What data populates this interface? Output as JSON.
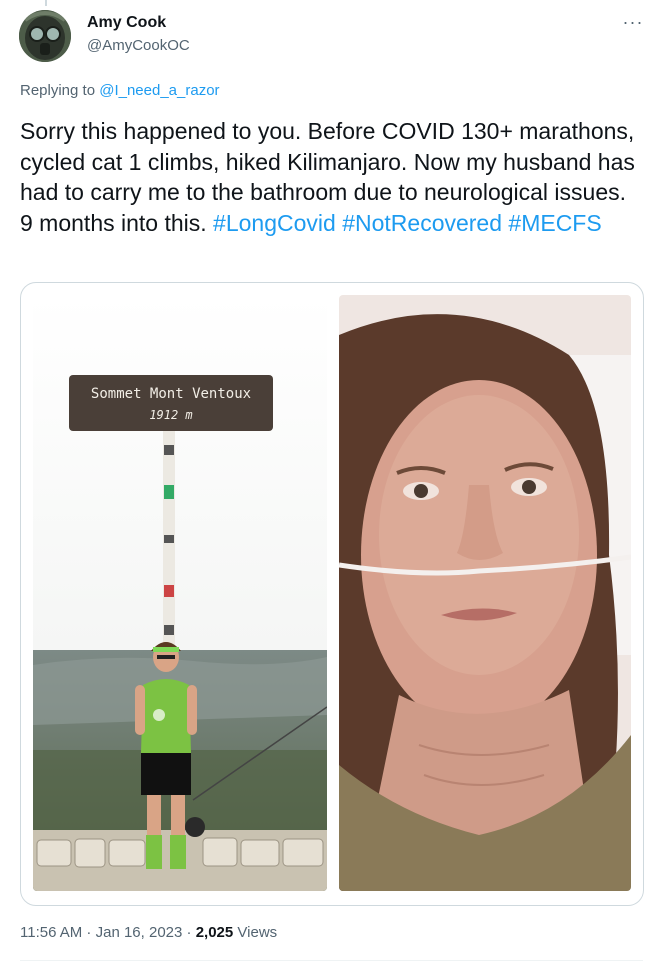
{
  "author": {
    "name": "Amy Cook",
    "handle": "@AmyCookOC",
    "avatar_icon": "gas-mask-avatar"
  },
  "more_label": "···",
  "reply": {
    "prefix": "Replying to ",
    "target": "@I_need_a_razor"
  },
  "text_segments": [
    "Sorry this happened to you. Before COVID 130+ marathons, cycled cat 1 climbs, hiked Kilimanjaro. Now my husband has had to carry me to the bathroom due to neurological issues. 9 months into this. ",
    "#LongCovid",
    "#NotRecovered",
    "#MECFS"
  ],
  "media": {
    "photo1": {
      "sign_title": "Sommet Mont Ventoux",
      "sign_altitude": "1912 m"
    },
    "photo2": {
      "subject": "selfie-with-nasal-cannula"
    }
  },
  "footer": {
    "time": "11:56 AM",
    "sep1": " · ",
    "date": "Jan 16, 2023",
    "sep2": " · ",
    "views_count": "2,025",
    "views_label": " Views"
  },
  "colors": {
    "link": "#1d9bf0",
    "secondary_text": "#536471",
    "primary_text": "#0f1419",
    "border": "#cfd9de"
  }
}
